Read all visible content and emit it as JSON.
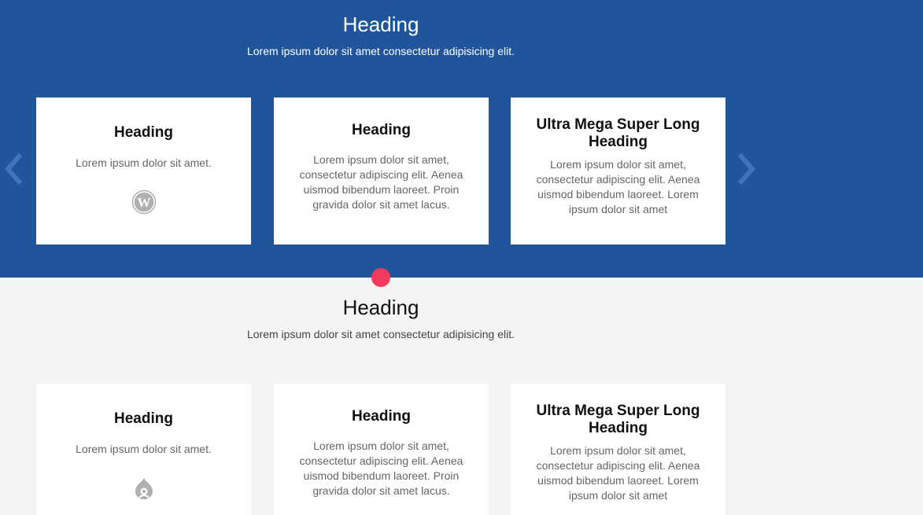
{
  "hero": {
    "title": "Heading",
    "subtitle": "Lorem ipsum dolor sit amet consectetur adipisicing elit.",
    "cards": [
      {
        "title": "Heading",
        "text": "Lorem ipsum dolor sit amet.",
        "icon": "wordpress-icon"
      },
      {
        "title": "Heading",
        "text": "Lorem ipsum dolor sit amet, consectetur adipiscing elit. Aenea uismod bibendum laoreet. Proin gravida dolor sit amet lacus."
      },
      {
        "title": "Ultra Mega Super Long Heading",
        "text": "Lorem ipsum dolor sit amet, consectetur adipiscing elit. Aenea uismod bibendum laoreet. Lorem ipsum dolor sit amet"
      }
    ],
    "prev_icon": "chevron-left-icon",
    "next_icon": "chevron-right-icon"
  },
  "features": {
    "title": "Heading",
    "subtitle": "Lorem ipsum dolor sit amet consectetur adipisicing elit.",
    "cards": [
      {
        "title": "Heading",
        "text": "Lorem ipsum dolor sit amet.",
        "icon": "drupal-icon"
      },
      {
        "title": "Heading",
        "text": "Lorem ipsum dolor sit amet, consectetur adipiscing elit. Aenea uismod bibendum laoreet. Proin gravida dolor sit amet lacus."
      },
      {
        "title": "Ultra Mega Super Long Heading",
        "text": "Lorem ipsum dolor sit amet, consectetur adipiscing elit. Aenea uismod bibendum laoreet. Lorem ipsum dolor sit amet"
      }
    ]
  },
  "colors": {
    "hero_background": "#21559b",
    "page_background": "#f4f4f4",
    "accent_dot": "#f43a5e",
    "arrow": "#3f73ba"
  }
}
